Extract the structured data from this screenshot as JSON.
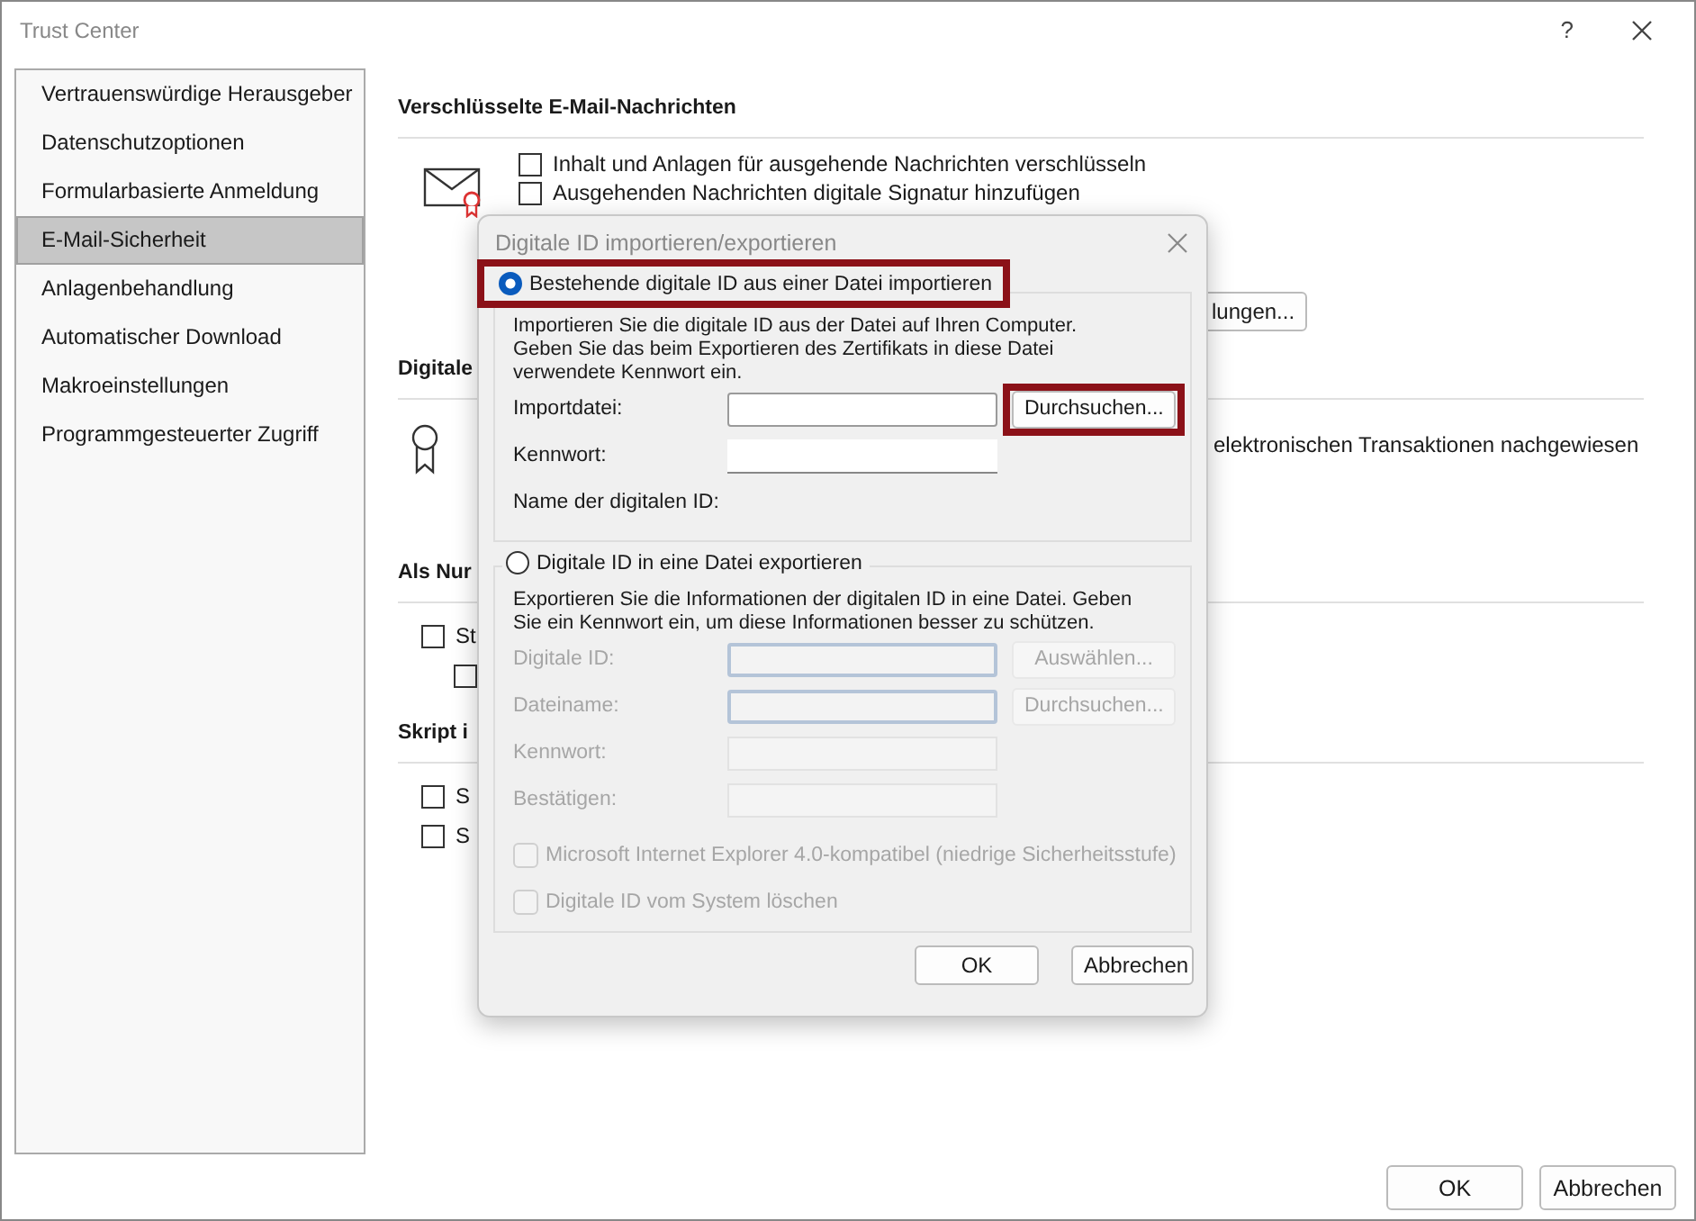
{
  "window": {
    "title": "Trust Center",
    "help": "?"
  },
  "sidebar": {
    "items": [
      {
        "label": "Vertrauenswürdige Herausgeber",
        "selected": false
      },
      {
        "label": "Datenschutzoptionen",
        "selected": false
      },
      {
        "label": "Formularbasierte Anmeldung",
        "selected": false
      },
      {
        "label": "E-Mail-Sicherheit",
        "selected": true
      },
      {
        "label": "Anlagenbehandlung",
        "selected": false
      },
      {
        "label": "Automatischer Download",
        "selected": false
      },
      {
        "label": "Makroeinstellungen",
        "selected": false
      },
      {
        "label": "Programmgesteuerter Zugriff",
        "selected": false
      }
    ]
  },
  "encrypted_mail": {
    "heading": "Verschlüsselte E-Mail-Nachrichten",
    "options": [
      {
        "label": "Inhalt und Anlagen für ausgehende Nachrichten verschlüsseln",
        "checked": false
      },
      {
        "label": "Ausgehenden Nachrichten digitale Signatur hinzufügen",
        "checked": false
      }
    ],
    "settings_button": "lungen..."
  },
  "digital_ids": {
    "heading": "Digitale",
    "text": "elektronischen Transaktionen nachgewiesen"
  },
  "plain_text": {
    "heading": "Als Nur",
    "options": [
      {
        "label": "St",
        "checked": false,
        "children": [
          {
            "checked": false
          }
        ]
      }
    ]
  },
  "script": {
    "heading": "Skript i",
    "options": [
      {
        "label": "S",
        "checked": false
      },
      {
        "label": "S",
        "checked": false
      }
    ]
  },
  "dialog": {
    "title": "Digitale ID importieren/exportieren",
    "groups": [
      {
        "label": "Bestehende digitale ID aus einer Datei importieren",
        "selected": true,
        "highlighted": true,
        "description": [
          "Importieren Sie die digitale ID aus der Datei auf Ihren Computer.",
          "Geben Sie das beim Exportieren des Zertifikats in diese Datei",
          "verwendete Kennwort ein."
        ],
        "fields": [
          {
            "label": "Importdatei:",
            "kind": "file",
            "disabled": false,
            "button": {
              "label": "Durchsuchen...",
              "highlighted": true
            }
          },
          {
            "label": "Kennwort:",
            "kind": "password",
            "disabled": false
          },
          {
            "label": "Name der digitalen ID:",
            "kind": "readout",
            "disabled": false
          }
        ]
      },
      {
        "label": "Digitale ID in eine Datei exportieren",
        "selected": false,
        "highlighted": false,
        "description": [
          "Exportieren Sie die Informationen der digitalen ID in eine Datei. Geben",
          "Sie ein Kennwort ein, um diese Informationen besser zu schützen."
        ],
        "fields": [
          {
            "label": "Digitale ID:",
            "kind": "file",
            "disabled": true,
            "button": {
              "label": "Auswählen...",
              "highlighted": false
            }
          },
          {
            "label": "Dateiname:",
            "kind": "file",
            "disabled": true,
            "button": {
              "label": "Durchsuchen...",
              "highlighted": false
            }
          },
          {
            "label": "Kennwort:",
            "kind": "password",
            "disabled": true
          },
          {
            "label": "Bestätigen:",
            "kind": "password",
            "disabled": true
          }
        ],
        "options": [
          {
            "label": "Microsoft Internet Explorer 4.0-kompatibel (niedrige Sicherheitsstufe)",
            "checked": false,
            "disabled": true
          },
          {
            "label": "Digitale ID vom System löschen",
            "checked": false,
            "disabled": true
          }
        ]
      }
    ],
    "buttons": [
      {
        "label": "OK"
      },
      {
        "label": "Abbrechen"
      }
    ]
  },
  "buttons": [
    {
      "label": "OK"
    },
    {
      "label": "Abbrechen"
    }
  ]
}
